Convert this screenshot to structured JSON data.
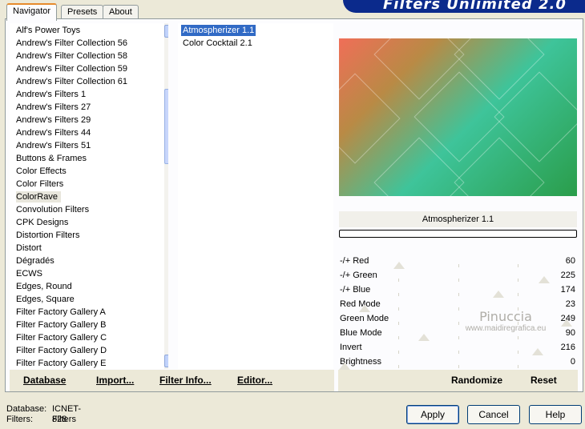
{
  "tabs": [
    "Navigator",
    "Presets",
    "About"
  ],
  "banner_title": "Filters Unlimited 2.0",
  "categories": [
    "Alf's Power Toys",
    "Andrew's Filter Collection 56",
    "Andrew's Filter Collection 58",
    "Andrew's Filter Collection 59",
    "Andrew's Filter Collection 61",
    "Andrew's Filters 1",
    "Andrew's Filters 27",
    "Andrew's Filters 29",
    "Andrew's Filters 44",
    "Andrew's Filters 51",
    "Buttons & Frames",
    "Color Effects",
    "Color Filters",
    "ColorRave",
    "Convolution Filters",
    "CPK Designs",
    "Distortion Filters",
    "Distort",
    "Dégradés",
    "ECWS",
    "Edges, Round",
    "Edges, Square",
    "Filter Factory Gallery A",
    "Filter Factory Gallery B",
    "Filter Factory Gallery C",
    "Filter Factory Gallery D",
    "Filter Factory Gallery E"
  ],
  "selected_category": "ColorRave",
  "filters": [
    "Atmospherizer 1.1",
    "Color Cocktail 2.1"
  ],
  "selected_filter": "Atmospherizer 1.1",
  "filter_name": "Atmospherizer 1.1",
  "params": [
    {
      "label": "-/+ Red",
      "value": "60",
      "level": 0.24
    },
    {
      "label": "-/+ Green",
      "value": "225",
      "level": 0.88
    },
    {
      "label": "-/+ Blue",
      "value": "174",
      "level": 0.68
    },
    {
      "label": "Red Mode",
      "value": "23",
      "level": 0.09
    },
    {
      "label": "Green Mode",
      "value": "249",
      "level": 0.98
    },
    {
      "label": "Blue Mode",
      "value": "90",
      "level": 0.35
    },
    {
      "label": "Invert",
      "value": "216",
      "level": 0.85
    },
    {
      "label": "Brightness",
      "value": "0",
      "level": 0.0
    }
  ],
  "watermark": {
    "line1": "Pinuccia",
    "line2": "www.maidiregrafica.eu"
  },
  "toolbar": {
    "database": "Database",
    "import": "Import...",
    "filter_info": "Filter Info...",
    "editor": "Editor..."
  },
  "preview_toolbar": {
    "randomize": "Randomize",
    "reset": "Reset"
  },
  "status": {
    "database_label": "Database:",
    "database_value": "ICNET-Filters",
    "filters_label": "Filters:",
    "filters_value": "828"
  },
  "buttons": {
    "apply": "Apply",
    "cancel": "Cancel",
    "help": "Help"
  }
}
